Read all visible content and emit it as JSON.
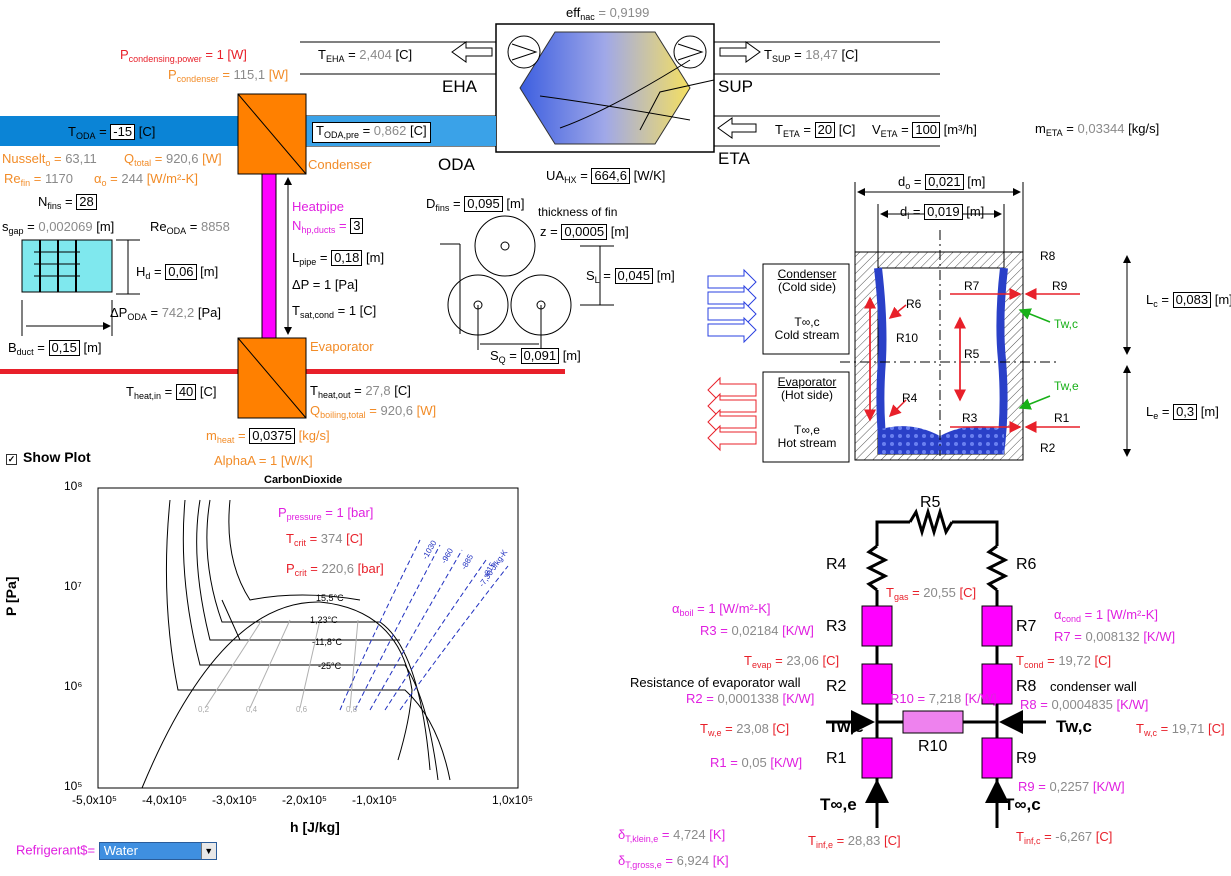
{
  "colors": {
    "red": "#e8202a",
    "gray": "#8a8a8a",
    "orange": "#f28c28",
    "magenta": "#e020e0",
    "duct_blue": "#0b84d6",
    "hx_orange": "#ff8000",
    "resistor": "#ff00ff",
    "resistor10": "#ee82ee"
  },
  "top": {
    "eff_nac": {
      "label": "eff",
      "sub": "nac",
      "value": "0,9199"
    },
    "t_eha": {
      "label": "T",
      "sub": "EHA",
      "value": "2,404",
      "unit": "[C]"
    },
    "eha": "EHA",
    "t_sup": {
      "label": "T",
      "sub": "SUP",
      "value": "18,47",
      "unit": "[C]"
    },
    "sup": "SUP",
    "t_eta": {
      "label": "T",
      "sub": "ETA",
      "value": "20",
      "unit": "[C]"
    },
    "v_eta": {
      "label": "V",
      "sub": "ETA",
      "value": "100",
      "unit": "[m³/h]"
    },
    "m_eta": {
      "label": "m",
      "sub": "ETA",
      "value": "0,03344",
      "unit": "[kg/s]"
    },
    "eta": "ETA",
    "oda": "ODA",
    "ua_hx": {
      "label": "UA",
      "sub": "HX",
      "value": "664,6",
      "unit": "[W/K]"
    }
  },
  "left": {
    "p_cond_power": {
      "label": "P",
      "sub": "condensing,power",
      "value": "1",
      "unit": "[W]"
    },
    "p_condenser": {
      "label": "P",
      "sub": "condenser",
      "value": "115,1",
      "unit": "[W]"
    },
    "t_oda": {
      "label": "T",
      "sub": "ODA",
      "value": "-15",
      "unit": "[C]"
    },
    "t_oda_pre": {
      "label": "T",
      "sub": "ODA,pre",
      "value": "0,862",
      "unit": "[C]"
    },
    "condenser": "Condenser",
    "nusselt": {
      "label": "Nusselt",
      "sub": "o",
      "value": "63,11"
    },
    "q_total": {
      "label": "Q",
      "sub": "total",
      "value": "920,6",
      "unit": "[W]"
    },
    "re_fin": {
      "label": "Re",
      "sub": "fin",
      "value": "1170"
    },
    "alpha_o": {
      "label": "α",
      "sub": "o",
      "value": "244",
      "unit": "[W/m²-K]"
    },
    "n_fins": {
      "label": "N",
      "sub": "fins",
      "value": "28"
    },
    "s_gap": {
      "label": "s",
      "sub": "gap",
      "value": "0,002069",
      "unit": "[m]"
    },
    "re_oda": {
      "label": "Re",
      "sub": "ODA",
      "value": "8858"
    },
    "h_d": {
      "label": "H",
      "sub": "d",
      "value": "0,06",
      "unit": "[m]"
    },
    "dp_oda": {
      "label": "ΔP",
      "sub": "ODA",
      "value": "742,2",
      "unit": "[Pa]"
    },
    "b_duct": {
      "label": "B",
      "sub": "duct",
      "value": "0,15",
      "unit": "[m]"
    },
    "heatpipe": "Heatpipe",
    "n_hp": {
      "label": "N",
      "sub": "hp,ducts",
      "value": "3"
    },
    "l_pipe": {
      "label": "L",
      "sub": "pipe",
      "value": "0,18",
      "unit": "[m]"
    },
    "dp": {
      "label": "ΔP",
      "value": "1",
      "unit": "[Pa]"
    },
    "t_sat": {
      "label": "T",
      "sub": "sat,cond",
      "value": "1",
      "unit": "[C]"
    },
    "evaporator": "Evaporator",
    "t_heat_in": {
      "label": "T",
      "sub": "heat,in",
      "value": "40",
      "unit": "[C]"
    },
    "t_heat_out": {
      "label": "T",
      "sub": "heat,out",
      "value": "27,8",
      "unit": "[C]"
    },
    "q_boiling": {
      "label": "Q",
      "sub": "boiling,total",
      "value": "920,6",
      "unit": "[W]"
    },
    "m_heat": {
      "label": "m",
      "sub": "heat",
      "value": "0,0375",
      "unit": "[kg/s]"
    },
    "alphaA": {
      "label": "AlphaA",
      "value": "1",
      "unit": "[W/K]"
    }
  },
  "fins": {
    "d_fins": {
      "label": "D",
      "sub": "fins",
      "value": "0,095",
      "unit": "[m]"
    },
    "thickness": "thickness of fin",
    "z": {
      "label": "z",
      "value": "0,0005",
      "unit": "[m]"
    },
    "s_l": {
      "label": "S",
      "sub": "L",
      "value": "0,045",
      "unit": "[m]"
    },
    "s_q": {
      "label": "S",
      "sub": "Q",
      "value": "0,091",
      "unit": "[m]"
    }
  },
  "pipe_diagram": {
    "d_o": {
      "label": "d",
      "sub": "o",
      "value": "0,021",
      "unit": "[m]"
    },
    "d_i": {
      "label": "d",
      "sub": "i",
      "value": "0,019",
      "unit": "[m]"
    },
    "l_c": {
      "label": "L",
      "sub": "c",
      "value": "0,083",
      "unit": "[m]"
    },
    "l_e": {
      "label": "L",
      "sub": "e",
      "value": "0,3",
      "unit": "[m]"
    },
    "condenser_side": [
      "Condenser",
      "(Cold side)"
    ],
    "cold_stream": [
      "T∞,c",
      "Cold stream"
    ],
    "evap_side": [
      "Evaporator",
      "(Hot side)"
    ],
    "hot_stream": [
      "T∞,e",
      "Hot stream"
    ],
    "labels": [
      "R8",
      "R9",
      "R7",
      "R6",
      "R5",
      "R10",
      "R4",
      "R3",
      "R1",
      "R2",
      "Tw,c",
      "Tw,e"
    ]
  },
  "show_plot": "Show Plot",
  "chart_data": {
    "type": "line",
    "title": "CarbonDioxide",
    "xlabel": "h [J/kg]",
    "ylabel": "P [Pa]",
    "xlim": [
      -500000,
      100000
    ],
    "ylim": [
      100000,
      100000000
    ],
    "yscale": "log",
    "x_ticks": [
      "-5,0x10⁵",
      "-4,0x10⁵",
      "-3,0x10⁵",
      "-2,0x10⁵",
      "-1,0x10⁵",
      "1,0x10⁵"
    ],
    "y_ticks": [
      "10⁸",
      "10⁷",
      "10⁶",
      "10⁵"
    ],
    "isotherm_labels": [
      "15,5°C",
      "1,23°C",
      "-11,8°C",
      "-25°C"
    ],
    "quality_labels": [
      "0,2",
      "0,4",
      "0,6",
      "0,8"
    ],
    "entropy_labels": [
      "-1030",
      "-960",
      "-885",
      "-815",
      "-7,30 J/kg-K"
    ],
    "annotations": {
      "p_pressure": {
        "label": "P",
        "sub": "pressure",
        "value": "1",
        "unit": "[bar]"
      },
      "t_crit": {
        "label": "T",
        "sub": "crit",
        "value": "374",
        "unit": "[C]"
      },
      "p_crit": {
        "label": "P",
        "sub": "crit",
        "value": "220,6",
        "unit": "[bar]"
      }
    }
  },
  "refrigerant": {
    "label": "Refrigerant$=",
    "value": "Water"
  },
  "bottom_left": {
    "dt_klein": {
      "label": "δ",
      "sub": "T,klein,e",
      "value": "4,724",
      "unit": "[K]"
    },
    "dt_gross": {
      "label": "δ",
      "sub": "T,gross,e",
      "value": "6,924",
      "unit": "[K]"
    }
  },
  "network": {
    "R5": "R5",
    "R4": "R4",
    "R6": "R6",
    "R3": "R3",
    "R7": "R7",
    "R2": "R2",
    "R8": "R8",
    "R1": "R1",
    "R9": "R9",
    "R10": "R10",
    "t_gas": {
      "label": "T",
      "sub": "gas",
      "value": "20,55",
      "unit": "[C]"
    },
    "alpha_boil": {
      "label": "α",
      "sub": "boil",
      "value": "1",
      "unit": "[W/m²-K]"
    },
    "r3_val": {
      "label": "R3",
      "value": "0,02184",
      "unit": "[K/W]"
    },
    "alpha_cond": {
      "label": "α",
      "sub": "cond",
      "value": "1",
      "unit": "[W/m²-K]"
    },
    "r7_val": {
      "label": "R7",
      "value": "0,008132",
      "unit": "[K/W]"
    },
    "t_evap": {
      "label": "T",
      "sub": "evap",
      "value": "23,06",
      "unit": "[C]"
    },
    "t_cond": {
      "label": "T",
      "sub": "cond",
      "value": "19,72",
      "unit": "[C]"
    },
    "evap_wall": "Resistance of evaporator wall",
    "cond_wall": "condenser wall",
    "r2_val": {
      "label": "R2",
      "value": "0,0001338",
      "unit": "[K/W]"
    },
    "r10_val": {
      "label": "R10",
      "value": "7,218",
      "unit": "[K/W]"
    },
    "r8_val": {
      "label": "R8",
      "value": "0,0004835",
      "unit": "[K/W]"
    },
    "t_we": {
      "label": "T",
      "sub": "w,e",
      "value": "23,08",
      "unit": "[C]"
    },
    "tw_e": "Tw,e",
    "tw_c": "Tw,c",
    "t_wc": {
      "label": "T",
      "sub": "w,c",
      "value": "19,71",
      "unit": "[C]"
    },
    "r1_val": {
      "label": "R1",
      "value": "0,05",
      "unit": "[K/W]"
    },
    "r9_val": {
      "label": "R9",
      "value": "0,2257",
      "unit": "[K/W]"
    },
    "t_inf_e_lbl": "T∞,e",
    "t_inf_c_lbl": "T∞,c",
    "t_inf_e": {
      "label": "T",
      "sub": "inf,e",
      "value": "28,83",
      "unit": "[C]"
    },
    "t_inf_c": {
      "label": "T",
      "sub": "inf,c",
      "value": "-6,267",
      "unit": "[C]"
    }
  }
}
